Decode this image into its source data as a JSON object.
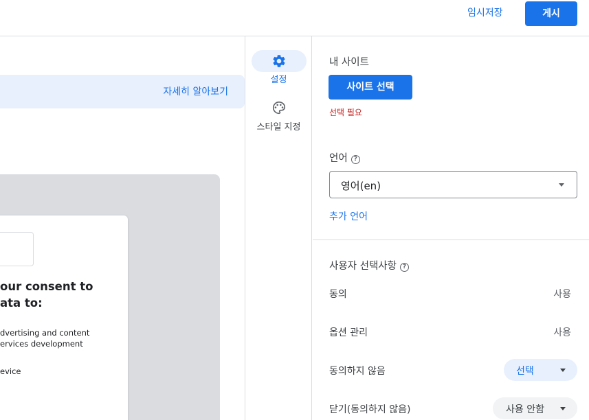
{
  "header": {
    "save_draft_label": "임시저장",
    "publish_label": "게시"
  },
  "preview": {
    "learn_more_label": "자세히 알아보기",
    "consent_heading_line1": "our consent to",
    "consent_heading_line2": "ata to:",
    "purpose_lines": [
      "dvertising and content",
      "ervices development",
      "evice"
    ]
  },
  "rail": {
    "items": [
      {
        "label": "설정",
        "icon": "gear-icon",
        "active": true
      },
      {
        "label": "스타일 지정",
        "icon": "palette-icon",
        "active": false
      }
    ]
  },
  "settings": {
    "my_site_title": "내 사이트",
    "select_site_label": "사이트 선택",
    "required_error": "선택 필요",
    "language_title": "언어",
    "language_value": "영어(en)",
    "add_language_label": "추가 언어",
    "user_choices_title": "사용자 선택사항",
    "choices": [
      {
        "label": "동의",
        "value": "사용"
      },
      {
        "label": "옵션 관리",
        "value": "사용"
      },
      {
        "label": "동의하지 않음",
        "value": "선택"
      },
      {
        "label": "닫기(동의하지 않음)",
        "value": "사용 안함"
      }
    ]
  },
  "colors": {
    "accent": "#1a73e8",
    "error": "#c5221f",
    "chip_selected": "#e8f0fe",
    "chip_default": "#f1f3f4"
  }
}
